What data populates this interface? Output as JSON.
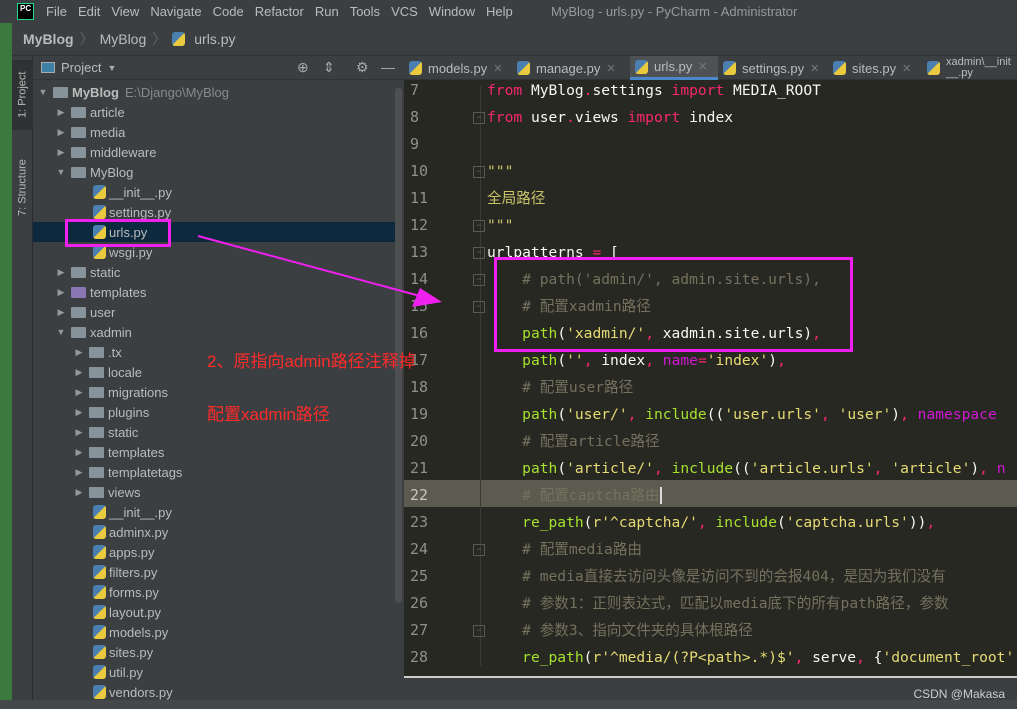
{
  "window": {
    "title": "MyBlog - urls.py - PyCharm - Administrator",
    "logo": "PC"
  },
  "menu": [
    "File",
    "Edit",
    "View",
    "Navigate",
    "Code",
    "Refactor",
    "Run",
    "Tools",
    "VCS",
    "Window",
    "Help"
  ],
  "breadcrumb": [
    "MyBlog",
    "MyBlog",
    "urls.py"
  ],
  "toolstrip": {
    "project": "1: Project",
    "structure": "7: Structure"
  },
  "panel": {
    "title": "Project",
    "tree": [
      {
        "label": "MyBlog",
        "hint": "E:\\Django\\MyBlog",
        "depth": 0,
        "kind": "folder",
        "expanded": true,
        "bold": true
      },
      {
        "label": "article",
        "depth": 1,
        "kind": "folder",
        "expanded": false
      },
      {
        "label": "media",
        "depth": 1,
        "kind": "folder",
        "expanded": false
      },
      {
        "label": "middleware",
        "depth": 1,
        "kind": "folder",
        "expanded": false
      },
      {
        "label": "MyBlog",
        "depth": 1,
        "kind": "folder",
        "expanded": true
      },
      {
        "label": "__init__.py",
        "depth": 2,
        "kind": "py"
      },
      {
        "label": "settings.py",
        "depth": 2,
        "kind": "py"
      },
      {
        "label": "urls.py",
        "depth": 2,
        "kind": "py",
        "selected": true
      },
      {
        "label": "wsgi.py",
        "depth": 2,
        "kind": "py"
      },
      {
        "label": "static",
        "depth": 1,
        "kind": "folder",
        "expanded": false
      },
      {
        "label": "templates",
        "depth": 1,
        "kind": "template-folder",
        "expanded": false
      },
      {
        "label": "user",
        "depth": 1,
        "kind": "folder",
        "expanded": false
      },
      {
        "label": "xadmin",
        "depth": 1,
        "kind": "folder",
        "expanded": true
      },
      {
        "label": ".tx",
        "depth": 2,
        "kind": "folder",
        "expanded": false
      },
      {
        "label": "locale",
        "depth": 2,
        "kind": "folder",
        "expanded": false
      },
      {
        "label": "migrations",
        "depth": 2,
        "kind": "folder",
        "expanded": false
      },
      {
        "label": "plugins",
        "depth": 2,
        "kind": "folder",
        "expanded": false
      },
      {
        "label": "static",
        "depth": 2,
        "kind": "folder",
        "expanded": false
      },
      {
        "label": "templates",
        "depth": 2,
        "kind": "folder",
        "expanded": false
      },
      {
        "label": "templatetags",
        "depth": 2,
        "kind": "folder",
        "expanded": false
      },
      {
        "label": "views",
        "depth": 2,
        "kind": "folder",
        "expanded": false
      },
      {
        "label": "__init__.py",
        "depth": 2,
        "kind": "py"
      },
      {
        "label": "adminx.py",
        "depth": 2,
        "kind": "py"
      },
      {
        "label": "apps.py",
        "depth": 2,
        "kind": "py"
      },
      {
        "label": "filters.py",
        "depth": 2,
        "kind": "py"
      },
      {
        "label": "forms.py",
        "depth": 2,
        "kind": "py"
      },
      {
        "label": "layout.py",
        "depth": 2,
        "kind": "py"
      },
      {
        "label": "models.py",
        "depth": 2,
        "kind": "py"
      },
      {
        "label": "sites.py",
        "depth": 2,
        "kind": "py"
      },
      {
        "label": "util.py",
        "depth": 2,
        "kind": "py"
      },
      {
        "label": "vendors.py",
        "depth": 2,
        "kind": "py"
      }
    ]
  },
  "tabs": [
    {
      "label": "models.py"
    },
    {
      "label": "manage.py"
    },
    {
      "label": "urls.py",
      "active": true
    },
    {
      "label": "settings.py"
    },
    {
      "label": "sites.py"
    },
    {
      "label": "xadmin\\__init__.py"
    }
  ],
  "code": {
    "current_line": 22,
    "lines": [
      {
        "n": 7,
        "t": [
          [
            "kw",
            "from"
          ],
          [
            "tx",
            " MyBlog"
          ],
          [
            "kw",
            "."
          ],
          [
            "tx",
            "settings "
          ],
          [
            "kw",
            "import"
          ],
          [
            "tx",
            " MEDIA_ROOT"
          ]
        ]
      },
      {
        "n": 8,
        "fold": true,
        "t": [
          [
            "kw",
            "from"
          ],
          [
            "tx",
            " user"
          ],
          [
            "kw",
            "."
          ],
          [
            "tx",
            "views "
          ],
          [
            "kw",
            "import"
          ],
          [
            "tx",
            " index"
          ]
        ]
      },
      {
        "n": 9,
        "t": []
      },
      {
        "n": 10,
        "fold": true,
        "t": [
          [
            "doc",
            "\"\"\""
          ]
        ]
      },
      {
        "n": 11,
        "t": [
          [
            "doc",
            "全局路径"
          ]
        ]
      },
      {
        "n": 12,
        "fold": true,
        "t": [
          [
            "doc",
            "\"\"\""
          ]
        ]
      },
      {
        "n": 13,
        "fold": true,
        "t": [
          [
            "tx",
            "urlpatterns "
          ],
          [
            "kw",
            "="
          ],
          [
            "tx",
            " ["
          ]
        ]
      },
      {
        "n": 14,
        "fold": true,
        "t": [
          [
            "cm",
            "    # path('admin/', admin.site.urls),"
          ]
        ]
      },
      {
        "n": 15,
        "fold": true,
        "t": [
          [
            "cm",
            "    # 配置xadmin路径"
          ]
        ]
      },
      {
        "n": 16,
        "t": [
          [
            "tx",
            "    "
          ],
          [
            "fn",
            "path"
          ],
          [
            "tx",
            "("
          ],
          [
            "st",
            "'xadmin/'"
          ],
          [
            "kw",
            ","
          ],
          [
            "tx",
            " xadmin.site.urls)"
          ],
          [
            "kw",
            ","
          ]
        ]
      },
      {
        "n": 17,
        "t": [
          [
            "tx",
            "    "
          ],
          [
            "fn",
            "path"
          ],
          [
            "tx",
            "("
          ],
          [
            "st",
            "''"
          ],
          [
            "kw",
            ","
          ],
          [
            "tx",
            " index"
          ],
          [
            "kw",
            ","
          ],
          [
            "tx",
            " "
          ],
          [
            "kv",
            "name"
          ],
          [
            "kw",
            "="
          ],
          [
            "st",
            "'index'"
          ],
          [
            "tx",
            ")"
          ],
          [
            "kw",
            ","
          ]
        ]
      },
      {
        "n": 18,
        "t": [
          [
            "cm",
            "    # 配置user路径"
          ]
        ]
      },
      {
        "n": 19,
        "t": [
          [
            "tx",
            "    "
          ],
          [
            "fn",
            "path"
          ],
          [
            "tx",
            "("
          ],
          [
            "st",
            "'user/'"
          ],
          [
            "kw",
            ","
          ],
          [
            "tx",
            " "
          ],
          [
            "fn",
            "include"
          ],
          [
            "tx",
            "(("
          ],
          [
            "st",
            "'user.urls'"
          ],
          [
            "kw",
            ","
          ],
          [
            "tx",
            " "
          ],
          [
            "st",
            "'user'"
          ],
          [
            "tx",
            ")"
          ],
          [
            "kw",
            ","
          ],
          [
            "tx",
            " "
          ],
          [
            "kv",
            "namespace"
          ]
        ]
      },
      {
        "n": 20,
        "t": [
          [
            "cm",
            "    # 配置article路径"
          ]
        ]
      },
      {
        "n": 21,
        "t": [
          [
            "tx",
            "    "
          ],
          [
            "fn",
            "path"
          ],
          [
            "tx",
            "("
          ],
          [
            "st",
            "'article/'"
          ],
          [
            "kw",
            ","
          ],
          [
            "tx",
            " "
          ],
          [
            "fn",
            "include"
          ],
          [
            "tx",
            "(("
          ],
          [
            "st",
            "'article.urls'"
          ],
          [
            "kw",
            ","
          ],
          [
            "tx",
            " "
          ],
          [
            "st",
            "'article'"
          ],
          [
            "tx",
            ")"
          ],
          [
            "kw",
            ","
          ],
          [
            "tx",
            " "
          ],
          [
            "kv",
            "n"
          ]
        ]
      },
      {
        "n": 22,
        "t": [
          [
            "cm",
            "    # 配置captcha路由"
          ]
        ]
      },
      {
        "n": 23,
        "t": [
          [
            "tx",
            "    "
          ],
          [
            "fn",
            "re_path"
          ],
          [
            "tx",
            "("
          ],
          [
            "st",
            "r'^captcha/'"
          ],
          [
            "kw",
            ","
          ],
          [
            "tx",
            " "
          ],
          [
            "fn",
            "include"
          ],
          [
            "tx",
            "("
          ],
          [
            "st",
            "'captcha.urls'"
          ],
          [
            "tx",
            "))"
          ],
          [
            "kw",
            ","
          ]
        ]
      },
      {
        "n": 24,
        "fold": true,
        "t": [
          [
            "cm",
            "    # 配置media路由"
          ]
        ]
      },
      {
        "n": 25,
        "t": [
          [
            "cm",
            "    # media直接去访问头像是访问不到的会报404，是因为我们没有"
          ]
        ]
      },
      {
        "n": 26,
        "t": [
          [
            "cm",
            "    # 参数1：正则表达式，匹配以media底下的所有path路径，参数"
          ]
        ]
      },
      {
        "n": 27,
        "fold": true,
        "t": [
          [
            "cm",
            "    # 参数3、指向文件夹的具体根路径"
          ]
        ]
      },
      {
        "n": 28,
        "t": [
          [
            "tx",
            "    "
          ],
          [
            "fn",
            "re_path"
          ],
          [
            "tx",
            "("
          ],
          [
            "st",
            "r'^media/(?P<path>.*)$'"
          ],
          [
            "kw",
            ","
          ],
          [
            "tx",
            " serve"
          ],
          [
            "kw",
            ","
          ],
          [
            "tx",
            " {"
          ],
          [
            "st",
            "'document_root'"
          ]
        ]
      }
    ]
  },
  "annotations": {
    "note1": "2、原指向admin路径注释掉",
    "note2": "配置xadmin路径",
    "color": "#f020f0",
    "text_color": "#ff2a2a"
  },
  "watermark": "CSDN @Makasa"
}
